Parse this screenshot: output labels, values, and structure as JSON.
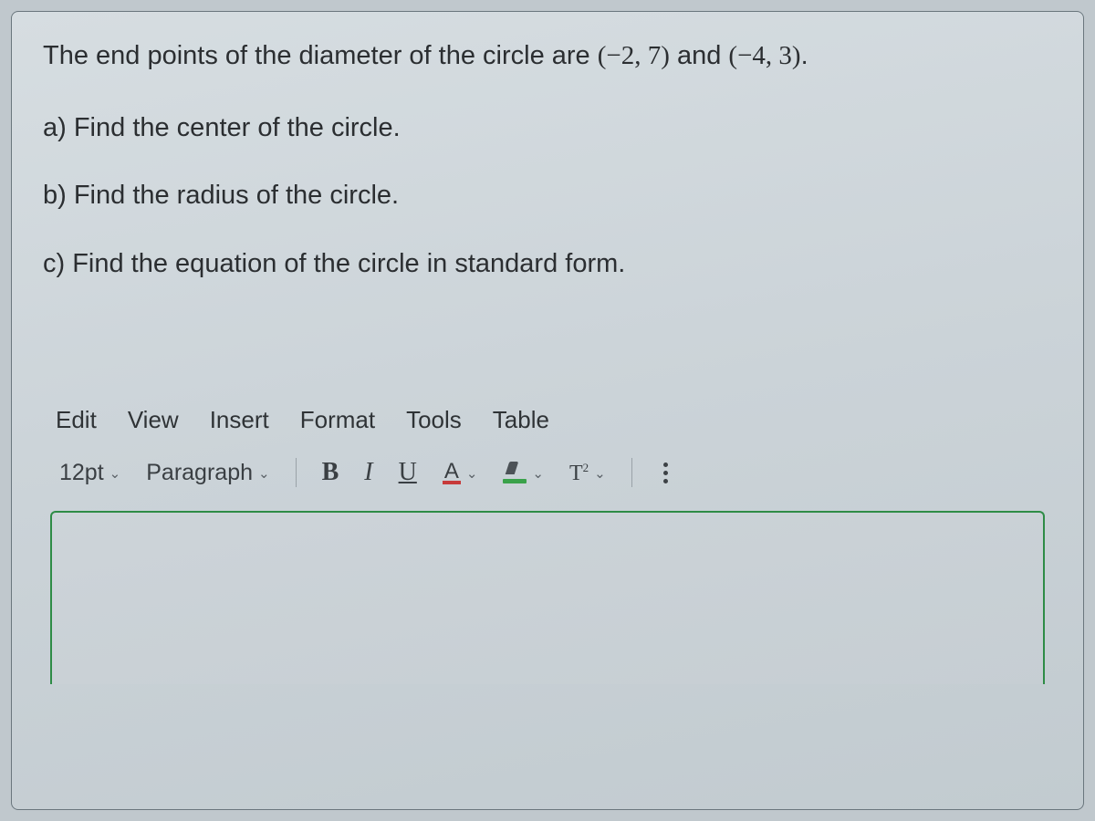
{
  "question": {
    "intro_prefix": "The end points of the diameter of the circle are ",
    "point1": "(−2, 7)",
    "connector": " and ",
    "point2": "(−4, 3)",
    "intro_suffix": ".",
    "parts": {
      "a": "a) Find the center of the circle.",
      "b": "b) Find the radius of the circle.",
      "c": "c) Find the equation of the circle in standard form."
    }
  },
  "editor": {
    "menus": {
      "edit": "Edit",
      "view": "View",
      "insert": "Insert",
      "format": "Format",
      "tools": "Tools",
      "table": "Table"
    },
    "toolbar": {
      "font_size": "12pt",
      "block_style": "Paragraph",
      "bold": "B",
      "italic": "I",
      "underline": "U",
      "text_color_glyph": "A",
      "superscript_glyph": "T"
    },
    "body_value": ""
  }
}
